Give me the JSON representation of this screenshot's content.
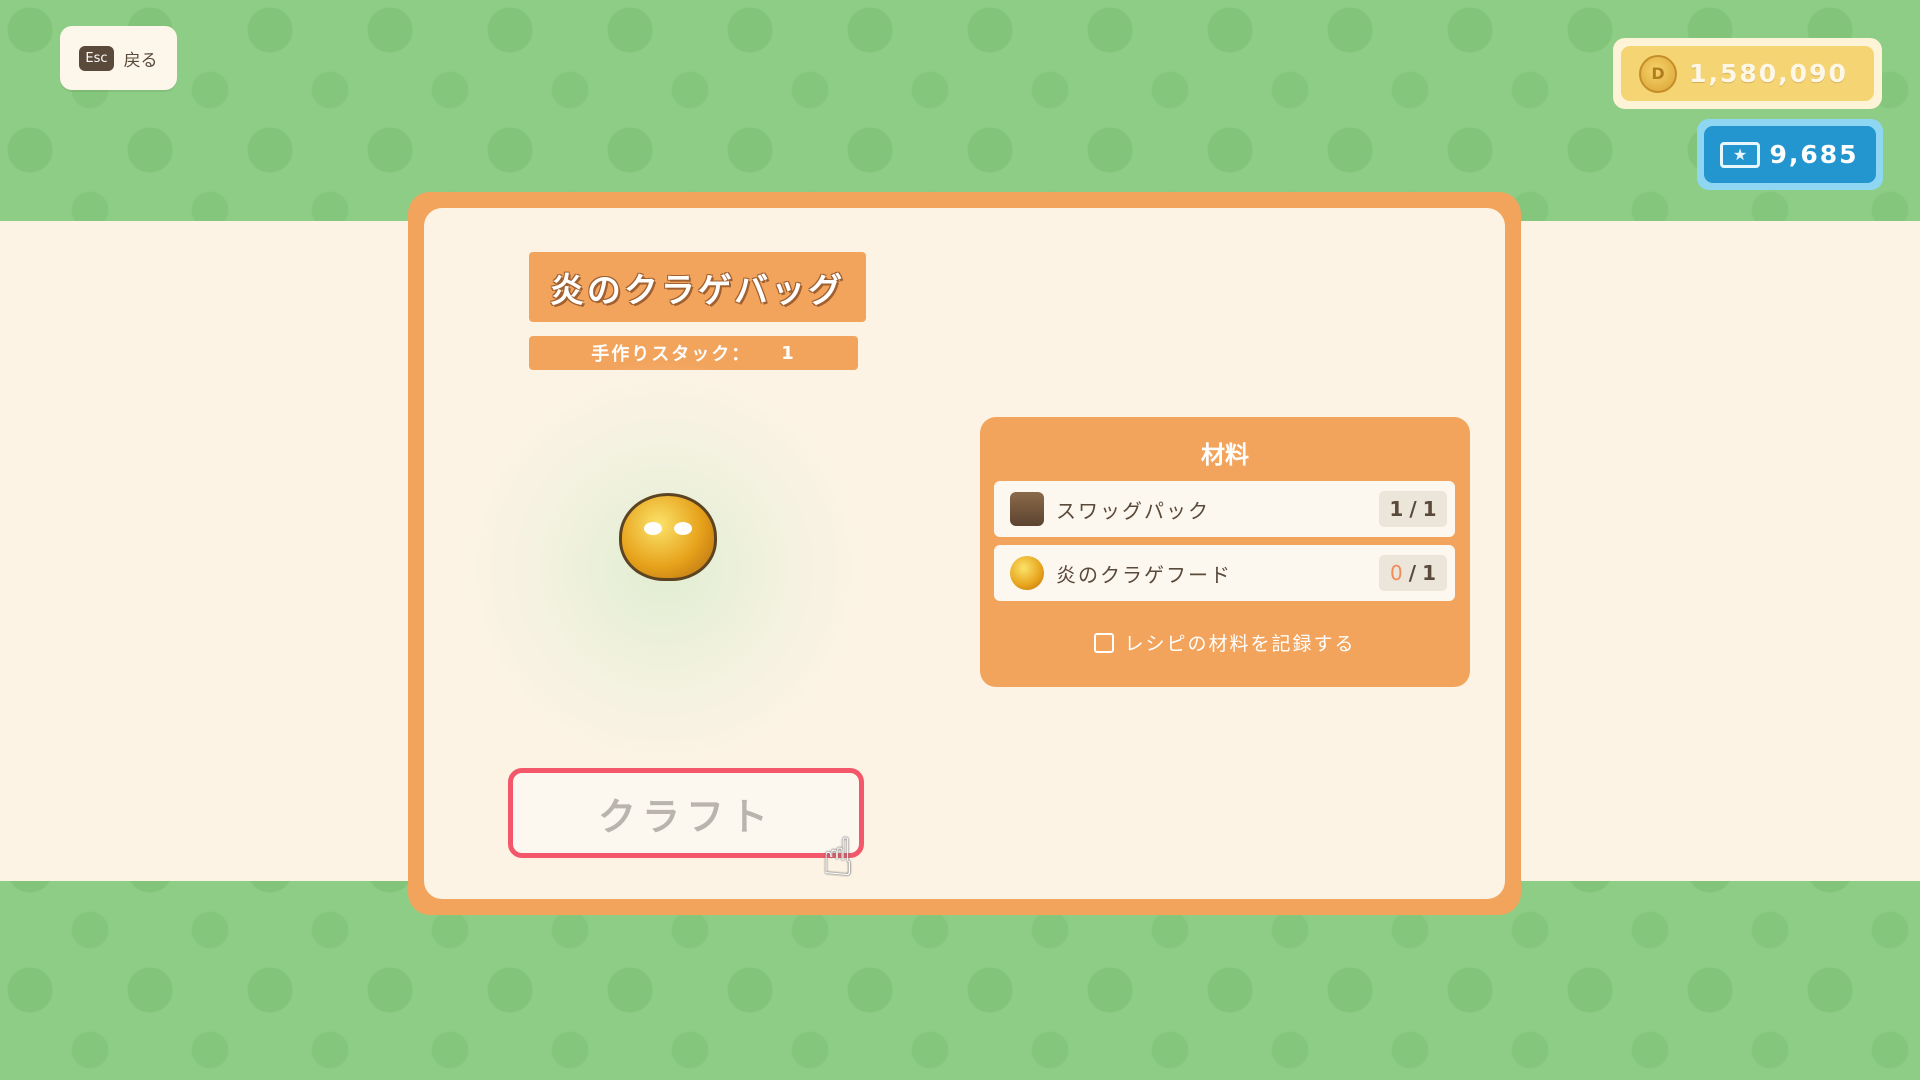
{
  "back_button": {
    "key": "Esc",
    "label": "戻る"
  },
  "currency": {
    "coins": "1,580,090",
    "tickets": "9,685"
  },
  "item": {
    "name": "炎のクラゲバッグ",
    "stack_label": "手作りスタック：",
    "stack_value": "1"
  },
  "craft_button": {
    "label": "クラフト"
  },
  "materials": {
    "title": "材料",
    "items": [
      {
        "name": "スワッグパック",
        "have": "1",
        "need": "1",
        "icon": "backpack-icon"
      },
      {
        "name": "炎のクラゲフード",
        "have": "0",
        "need": "1",
        "icon": "jellyfish-food-icon"
      }
    ],
    "record_label": "レシピの材料を記録する"
  },
  "colors": {
    "background_green": "#8ecd86",
    "panel_orange": "#f2a45d",
    "cream": "#fdf3e4",
    "craft_border": "#f2586a",
    "coin_gold": "#f5d474",
    "ticket_blue": "#2395cf"
  }
}
